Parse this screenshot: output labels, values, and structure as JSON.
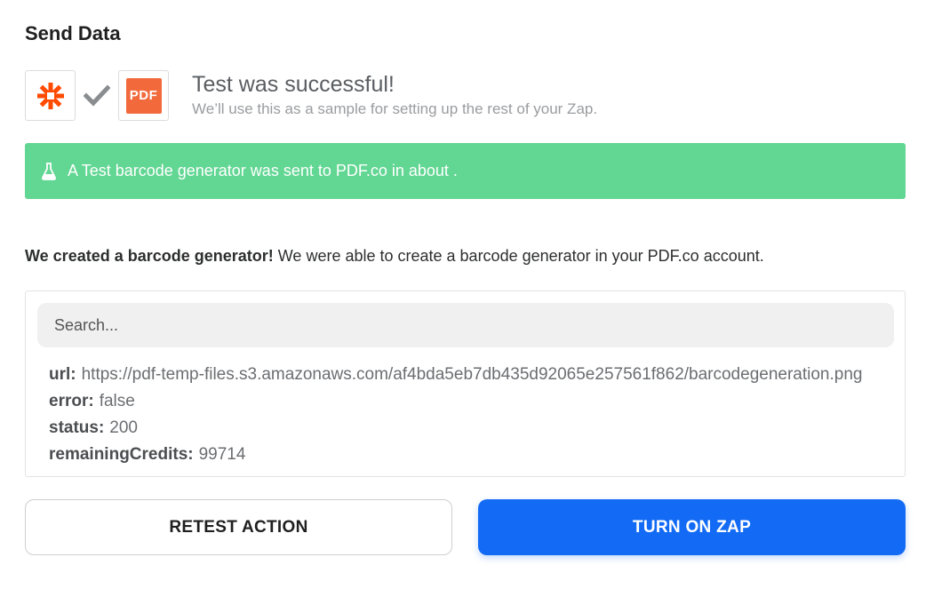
{
  "section": {
    "title": "Send Data"
  },
  "apps": {
    "trigger_icon": "zapier-icon",
    "connector_icon": "check-icon",
    "action_icon": "pdf-co-icon",
    "action_logo_text": "PDF"
  },
  "status": {
    "title": "Test was successful!",
    "subtitle": "We’ll use this as a sample for setting up the rest of your Zap."
  },
  "banner": {
    "icon": "flask-icon",
    "text": "A Test barcode generator was sent to PDF.co in about .",
    "color": "#62d693"
  },
  "result": {
    "bold": "We created a barcode generator!",
    "text": " We were able to create a barcode generator in your PDF.co account."
  },
  "search": {
    "placeholder": "Search..."
  },
  "fields": [
    {
      "key": "url:",
      "value": "https://pdf-temp-files.s3.amazonaws.com/af4bda5eb7db435d92065e257561f862/barcodegeneration.png"
    },
    {
      "key": "error:",
      "value": "false"
    },
    {
      "key": "status:",
      "value": "200"
    },
    {
      "key": "remainingCredits:",
      "value": "99714"
    }
  ],
  "buttons": {
    "retest_label": "RETEST ACTION",
    "turn_on_label": "TURN ON ZAP",
    "primary_color": "#136bf5"
  }
}
